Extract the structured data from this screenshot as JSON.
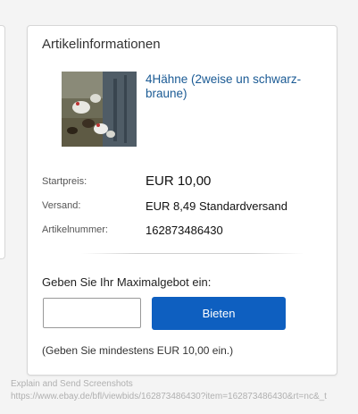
{
  "card": {
    "title": "Artikelinformationen"
  },
  "item": {
    "image_alt": "4Hähne (2weise un schwarz-braune)",
    "link": "4Hähne (2weise un schwarz-braune)"
  },
  "details": {
    "start_label": "Startpreis:",
    "start_value": "EUR 10,00",
    "shipping_label": "Versand:",
    "shipping_value": "EUR 8,49 Standardversand",
    "number_label": "Artikelnummer:",
    "number_value": "162873486430"
  },
  "bid": {
    "label": "Geben Sie Ihr Maximalgebot ein:",
    "input_value": "",
    "button_label": "Bieten",
    "hint": "(Geben Sie mindestens EUR 10,00 ein.)"
  },
  "overlay": {
    "line1": "Explain and Send Screenshots",
    "line2": "https://www.ebay.de/bfl/viewbids/162873486430?item=162873486430&rt=nc&_t"
  }
}
